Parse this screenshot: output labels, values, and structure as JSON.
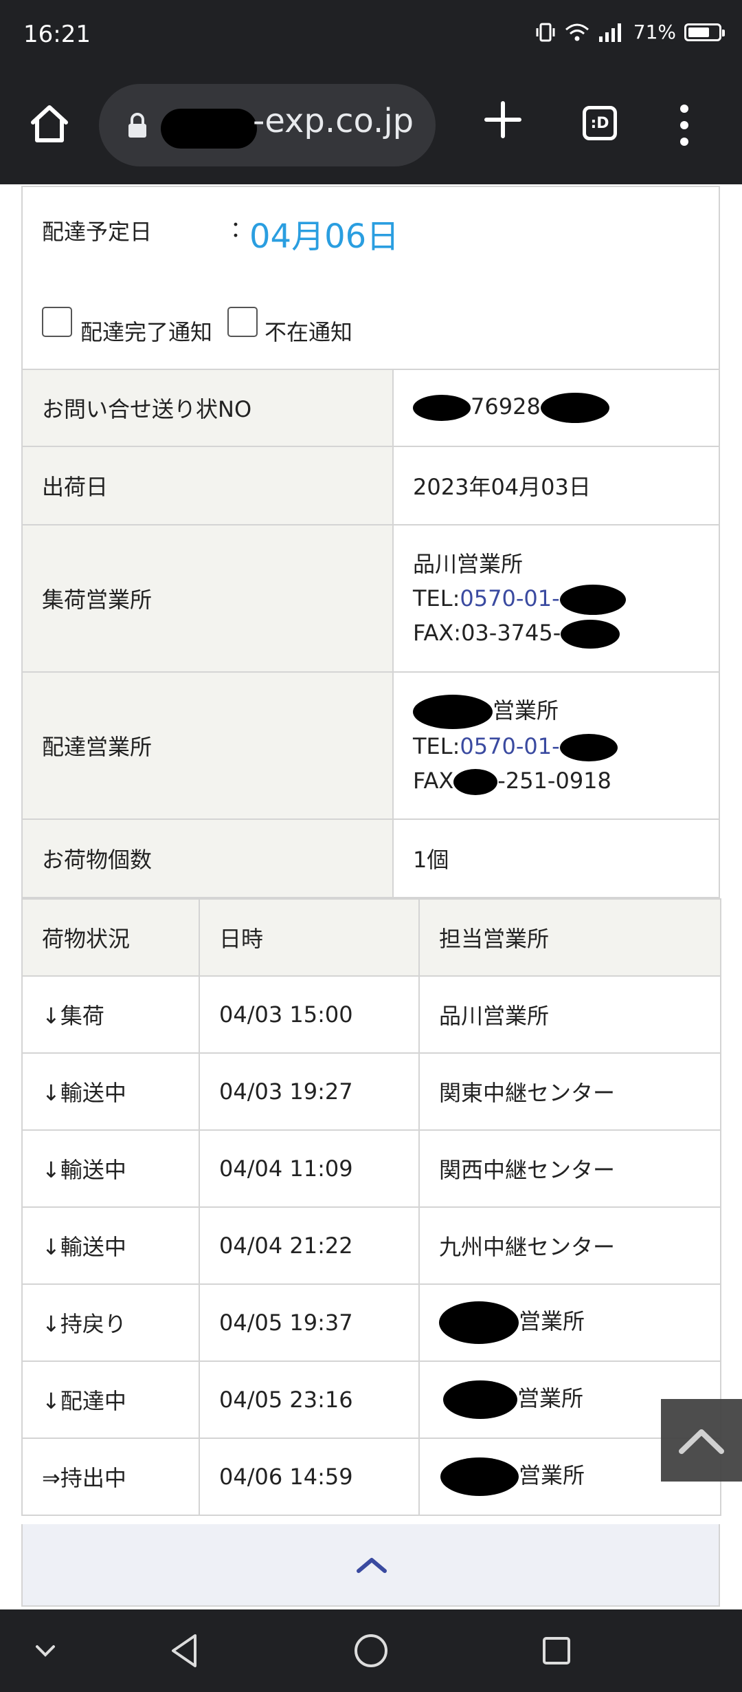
{
  "status_bar": {
    "time": "16:21",
    "battery_percent": "71%",
    "battery_level": 0.71
  },
  "browser": {
    "url_visible": "-exp.co.jp",
    "tabs_label": ":D"
  },
  "delivery": {
    "label": "配達予定日",
    "colon": "：",
    "value": "04月06日"
  },
  "notify": {
    "complete_label": "配達完了通知",
    "absent_label": "不在通知"
  },
  "info": {
    "tracking_label": "お問い合せ送り状NO",
    "tracking_value": "76928",
    "ship_date_label": "出荷日",
    "ship_date_value": "2023年04月03日",
    "pickup_office_label": "集荷営業所",
    "pickup_office_name": "品川営業所",
    "pickup_tel_prefix": "TEL:",
    "pickup_tel_link": "0570-01-",
    "pickup_fax": "FAX:03-3745-",
    "delivery_office_label": "配達営業所",
    "delivery_office_name": "営業所",
    "delivery_tel_prefix": "TEL:",
    "delivery_tel_link": "0570-01-",
    "delivery_fax_prefix": "FAX",
    "delivery_fax_suffix": "-251-0918",
    "pieces_label": "お荷物個数",
    "pieces_value": "1個"
  },
  "history": {
    "headers": [
      "荷物状況",
      "日時",
      "担当営業所"
    ],
    "rows": [
      {
        "status": "↓集荷",
        "datetime": "04/03 15:00",
        "office": "品川営業所"
      },
      {
        "status": "↓輸送中",
        "datetime": "04/03 19:27",
        "office": "関東中継センター"
      },
      {
        "status": "↓輸送中",
        "datetime": "04/04 11:09",
        "office": "関西中継センター"
      },
      {
        "status": "↓輸送中",
        "datetime": "04/04 21:22",
        "office": "九州中継センター"
      },
      {
        "status": "↓持戻り",
        "datetime": "04/05 19:37",
        "office": "営業所"
      },
      {
        "status": "↓配達中",
        "datetime": "04/05 23:16",
        "office": "営業所"
      },
      {
        "status": "⇒持出中",
        "datetime": "04/06 14:59",
        "office": "営業所"
      }
    ]
  },
  "colors": {
    "accent": "#2a9ee0",
    "link": "#3a4aa0",
    "header_bg": "#f3f3ef",
    "chrome_bg": "#202124"
  },
  "icons": [
    "home-icon",
    "lock-icon",
    "plus-icon",
    "tabs-icon",
    "more-vert-icon",
    "chevron-up-icon",
    "back-nav-icon",
    "home-nav-icon",
    "recents-nav-icon",
    "chevron-down-icon"
  ]
}
